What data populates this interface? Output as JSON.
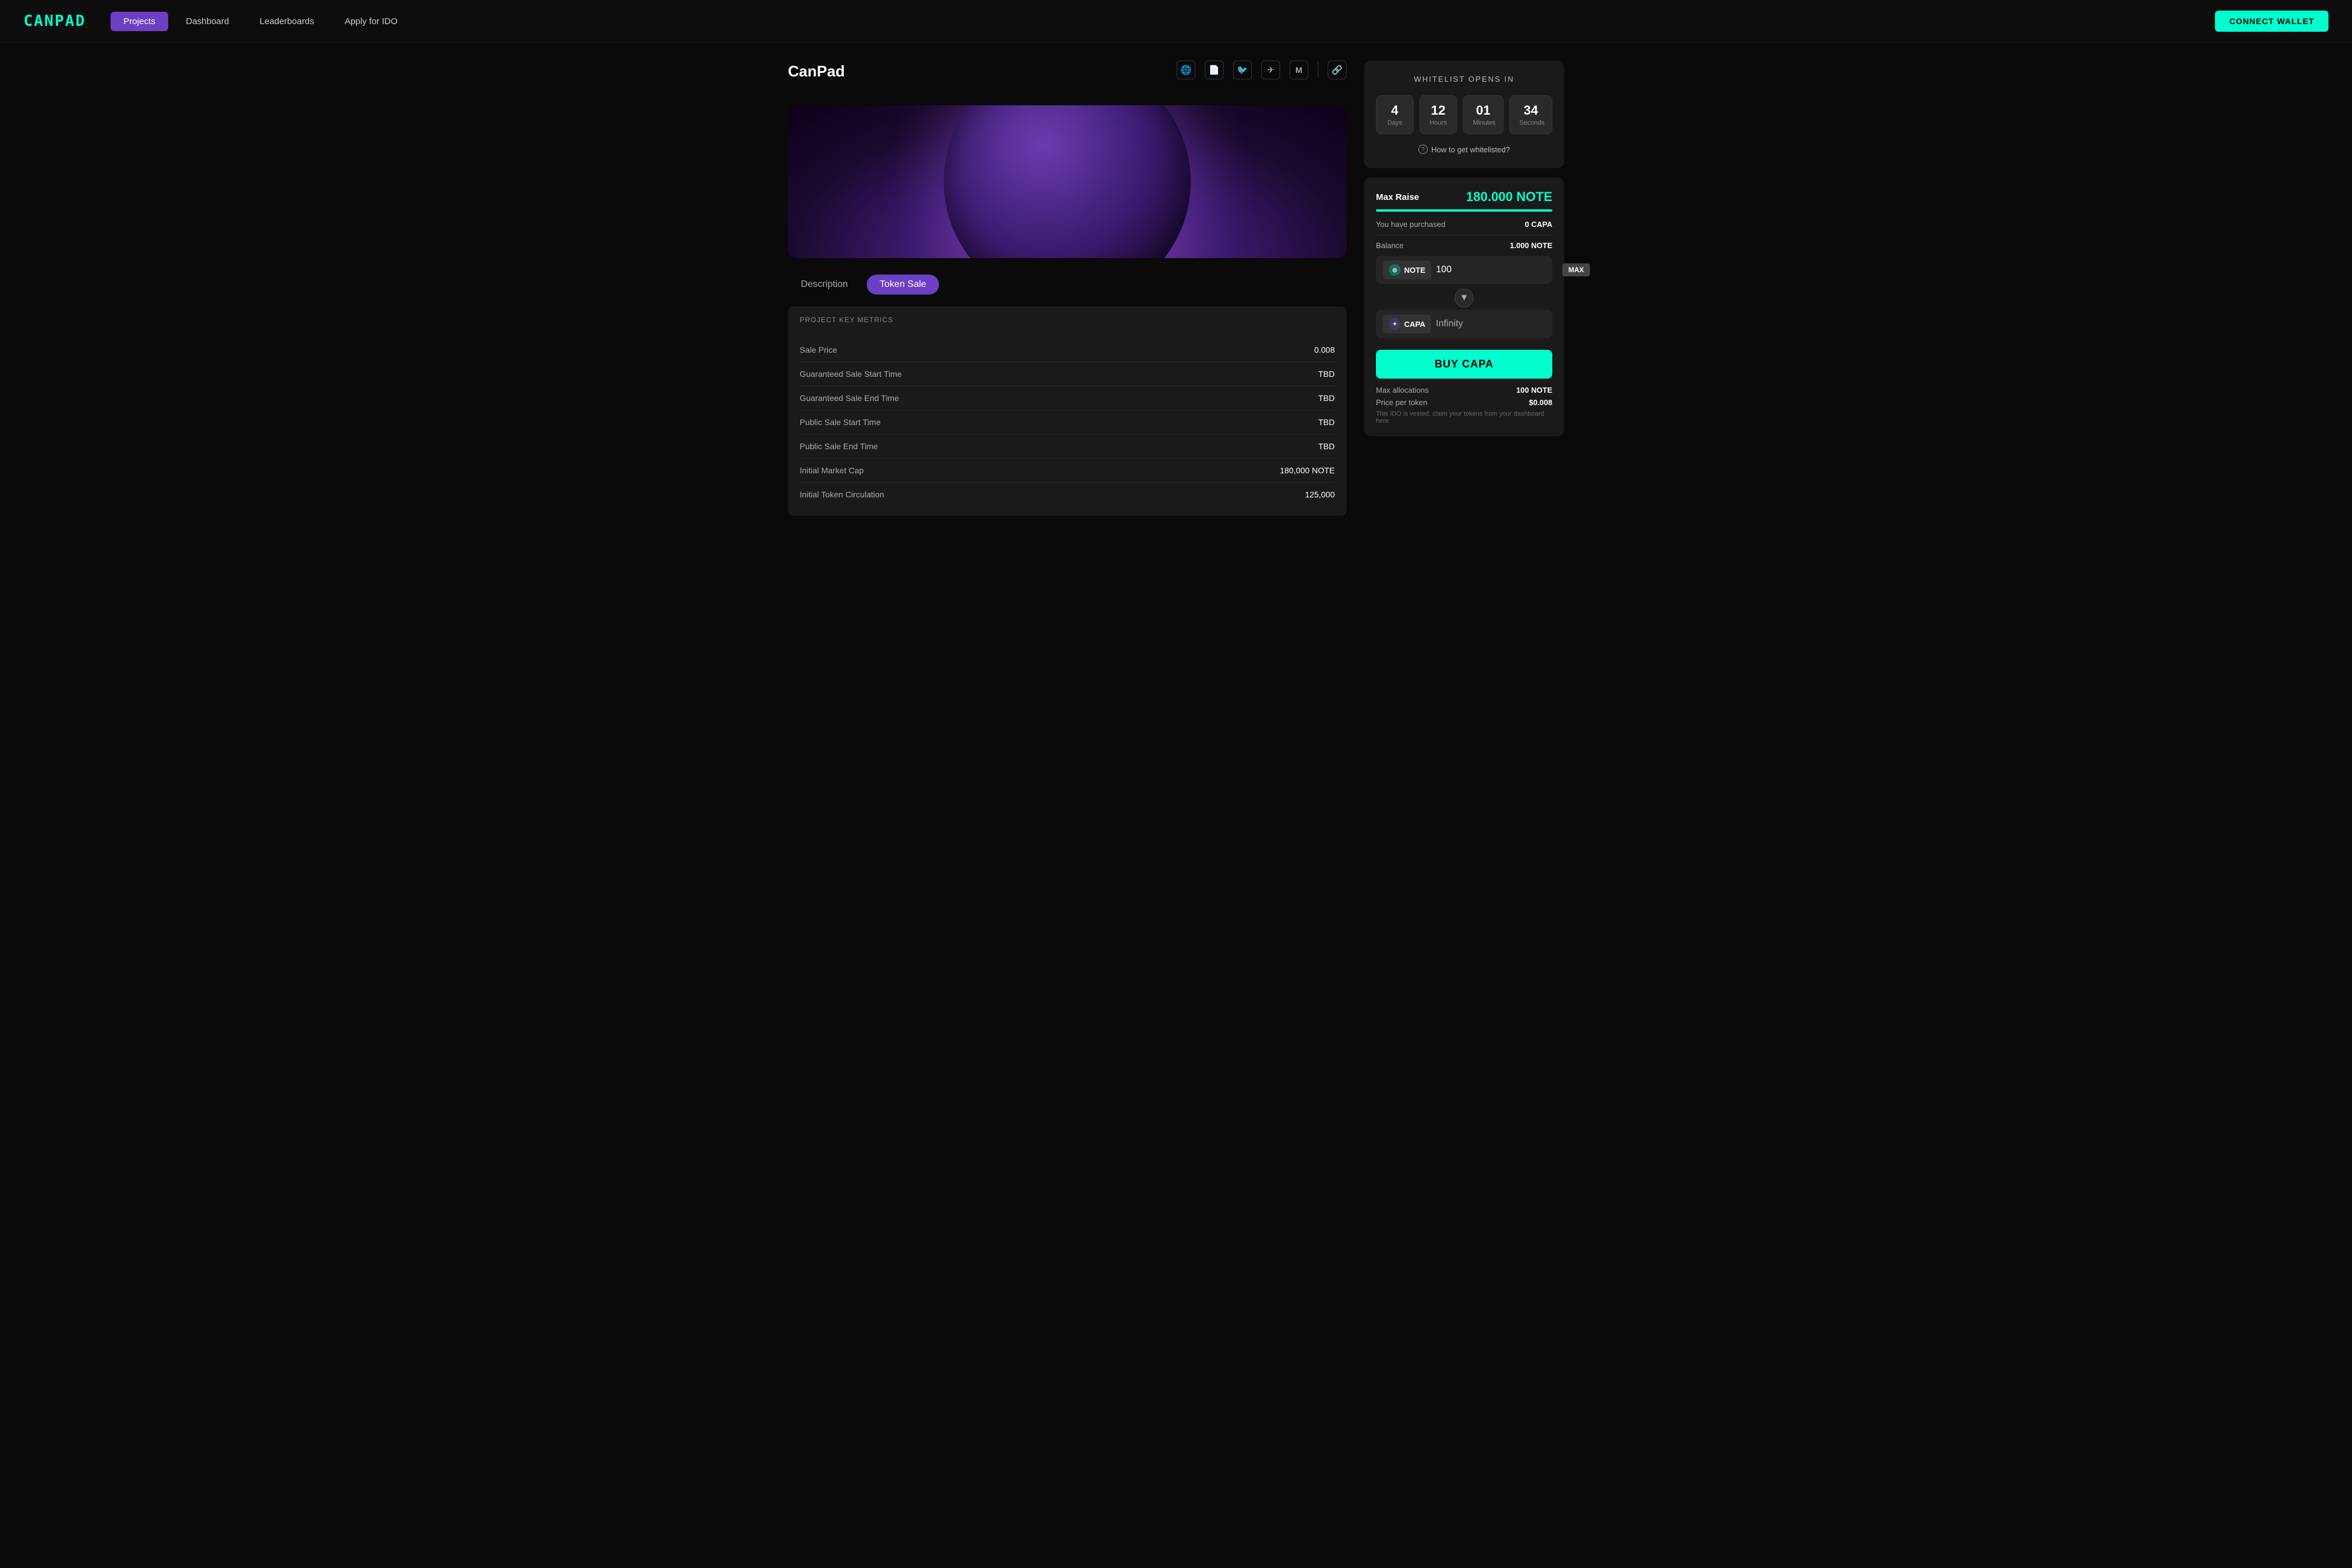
{
  "app": {
    "logo": "CANPAD"
  },
  "nav": {
    "links": [
      {
        "label": "Projects",
        "active": true
      },
      {
        "label": "Dashboard",
        "active": false
      },
      {
        "label": "Leaderboards",
        "active": false
      },
      {
        "label": "Apply for IDO",
        "active": false
      }
    ],
    "connect_wallet": "CONNECT WALLET"
  },
  "page": {
    "title": "CanPad"
  },
  "social": {
    "icons": [
      "🌐",
      "📄",
      "🐦",
      "✈",
      "M",
      "|",
      "🔗"
    ]
  },
  "tabs": [
    {
      "label": "Description",
      "active": false
    },
    {
      "label": "Token Sale",
      "active": true
    }
  ],
  "metrics": {
    "section_title": "PROJECT KEY METRICS",
    "rows": [
      {
        "label": "Sale Price",
        "value": "0.008"
      },
      {
        "label": "Guaranteed Sale Start Time",
        "value": "TBD"
      },
      {
        "label": "Guaranteed Sale End Time",
        "value": "TBD"
      },
      {
        "label": "Public Sale Start Time",
        "value": "TBD"
      },
      {
        "label": "Public Sale End Time",
        "value": "TBD"
      },
      {
        "label": "Initial Market Cap",
        "value": "180,000 NOTE"
      },
      {
        "label": "Initial Token Circulation",
        "value": "125,000"
      }
    ]
  },
  "whitelist": {
    "title": "WHITELIST OPENS IN",
    "countdown": [
      {
        "num": "4",
        "label": "Days"
      },
      {
        "num": "12",
        "label": "Hours"
      },
      {
        "num": "01",
        "label": "Minutes"
      },
      {
        "num": "34",
        "label": "Seconds"
      }
    ],
    "link_text": "How to get whitelisted?"
  },
  "trade": {
    "max_raise_label": "Max Raise",
    "max_raise_value": "180.000 NOTE",
    "progress_pct": 100,
    "purchased_label": "You have purchased",
    "purchased_value": "0 CAPA",
    "balance_label": "Balance",
    "balance_value": "1.000 NOTE",
    "from_token": "NOTE",
    "from_amount": "100",
    "to_token": "CAPA",
    "to_amount": "Infinity",
    "max_label": "MAX",
    "buy_button": "BUY CAPA",
    "max_allocations_label": "Max allocations",
    "max_allocations_value": "100 NOTE",
    "price_per_token_label": "Price per token",
    "price_per_token_value": "$0.008",
    "vested_note": "This IDO is vested, claim your tokens from your dashboard here"
  }
}
